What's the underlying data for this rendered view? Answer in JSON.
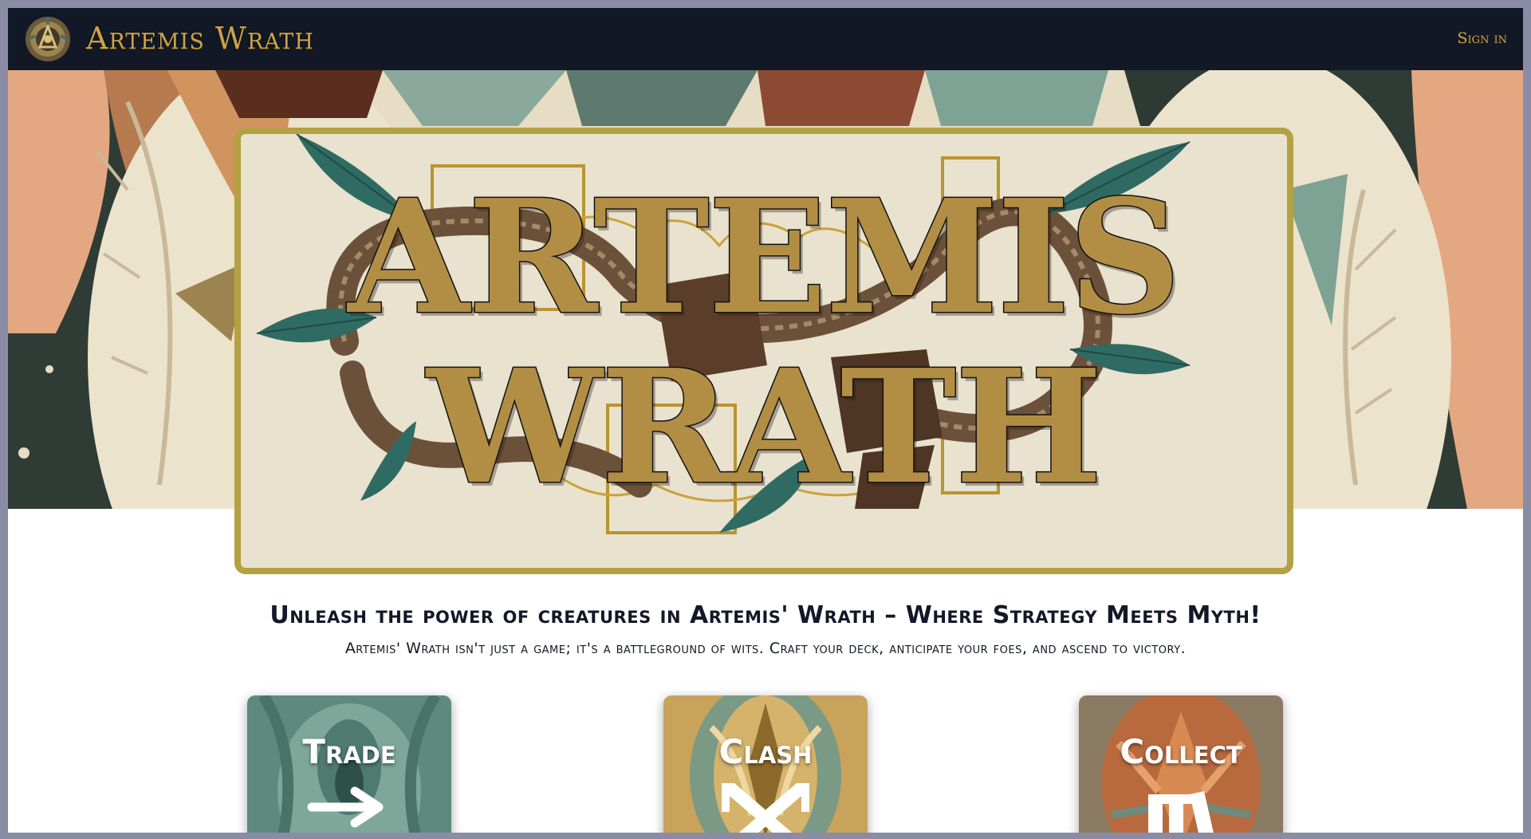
{
  "nav": {
    "brand": "Artemis Wrath",
    "signin_label": "Sign in",
    "logo_icon": "crest-emblem-icon"
  },
  "hero": {
    "banner_line_1": "ARTEMIS",
    "banner_line_2": "WRATH"
  },
  "intro": {
    "headline": "Unleash the power of creatures in Artemis' Wrath – Where Strategy Meets Myth!",
    "subline": "Artemis' Wrath isn't just a game; it's a battleground of wits. Craft your deck, anticipate your foes, and ascend to victory."
  },
  "cards": [
    {
      "label": "Trade",
      "icon": "arrow-right-icon",
      "color": "#5e8a7e"
    },
    {
      "label": "Clash",
      "icon": "crossed-swords-icon",
      "color": "#c9a35a"
    },
    {
      "label": "Collect",
      "icon": "card-stack-icon",
      "color": "#b8693e"
    }
  ],
  "colors": {
    "nav_bg": "#121826",
    "brand_gold": "#c9a24a",
    "banner_border": "#b3a142",
    "banner_bg": "#e9e2cf",
    "text_dark": "#121826"
  }
}
